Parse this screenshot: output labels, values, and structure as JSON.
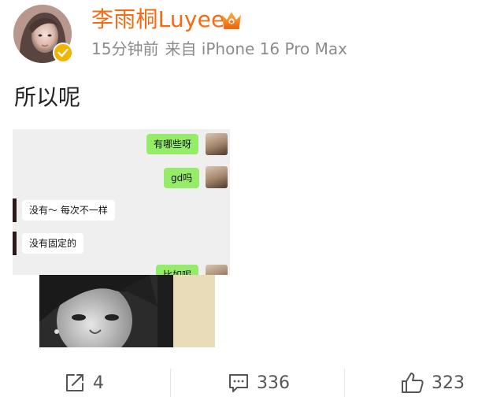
{
  "post": {
    "author": {
      "name": "李雨桐Luyee",
      "avatar_icon": "user-avatar",
      "verified_icon": "verified-badge-icon",
      "crown_icon": "crown-icon"
    },
    "meta": {
      "time": "15分钟前",
      "source": "来自 iPhone 16 Pro Max"
    },
    "text": "所以呢",
    "chat_image": {
      "messages": [
        {
          "side": "right",
          "text": "有哪些呀"
        },
        {
          "side": "right",
          "text": "gd吗"
        },
        {
          "side": "left",
          "text": "没有～ 每次不一样"
        },
        {
          "side": "left",
          "text": "没有固定的"
        },
        {
          "side": "right",
          "text": "比如呢"
        }
      ]
    }
  },
  "actions": {
    "repost": {
      "icon": "share-icon",
      "count": "4"
    },
    "comment": {
      "icon": "comment-icon",
      "count": "336"
    },
    "like": {
      "icon": "thumbs-up-icon",
      "count": "323"
    }
  },
  "colors": {
    "username": "#f56b14",
    "meta": "#8c8c8c",
    "wechat_green": "#95ec69",
    "badge_yellow": "#f3b400"
  }
}
